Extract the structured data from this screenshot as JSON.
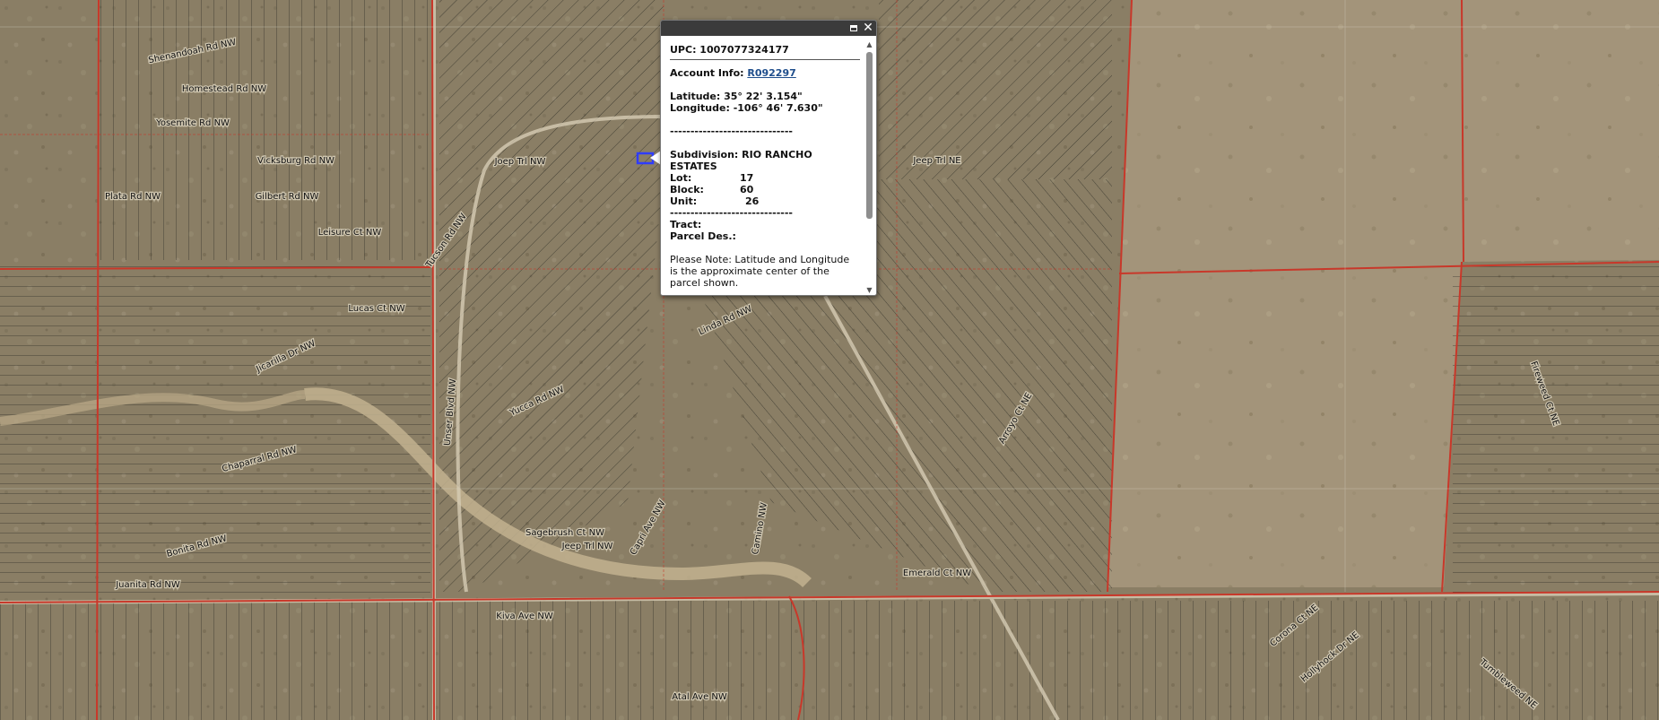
{
  "popup": {
    "upc": "UPC: 1007077324177",
    "account_label": "Account Info: ",
    "account_link": "R092297",
    "latitude": "Latitude: 35° 22' 3.154\"",
    "longitude": "Longitude: -106° 46' 7.630\"",
    "separator": "------------------------------",
    "subdivision": "Subdivision: RIO RANCHO ESTATES",
    "lot_label": "Lot:",
    "lot_value": "17",
    "block_label": "Block:",
    "block_value": "60",
    "unit_label": "Unit:",
    "unit_value": "26",
    "tract_label": "Tract:",
    "parcel_label": "Parcel Des.:",
    "note": "Please Note: Latitude and Longitude is the approximate center of the parcel shown.",
    "maximize_icon": "maximize-icon",
    "close_icon": "close-icon",
    "close_glyph": "✕"
  },
  "colors": {
    "terrain": "#8d8168",
    "parcel_line": "#2b2b24",
    "boundary": "#c8382a",
    "selected_parcel": "#2f3cff",
    "popup_titlebar": "#3b3b3b"
  },
  "street_labels": [
    {
      "text": "Shenandoah Rd NW"
    },
    {
      "text": "Homestead Rd NW"
    },
    {
      "text": "Yosemite Rd NW"
    },
    {
      "text": "Vicksburg Rd NW"
    },
    {
      "text": "Gilbert Rd NW"
    },
    {
      "text": "Leisure Ct NW"
    },
    {
      "text": "Plata Rd NW"
    },
    {
      "text": "Lucas Ct NW"
    },
    {
      "text": "Yucca Rd NW"
    },
    {
      "text": "Joep Trl NW"
    },
    {
      "text": "Juanita Rd NW"
    },
    {
      "text": "Jeep Trl NE"
    },
    {
      "text": "Emerald Ct NW"
    },
    {
      "text": "Atal Ave NW"
    },
    {
      "text": "Kiva Ave NW"
    },
    {
      "text": "Sagebrush Ct NW"
    },
    {
      "text": "Jeep Trl NW"
    },
    {
      "text": "Capri Ave NW"
    },
    {
      "text": "Bonita Rd NW"
    },
    {
      "text": "Arroyo Ct NE"
    },
    {
      "text": "Chaparral Rd NW"
    },
    {
      "text": "Jicarilla Dr NW"
    },
    {
      "text": "Tucson Rd NW"
    },
    {
      "text": "Unser Blvd NW"
    },
    {
      "text": "Tumbleweed NE"
    },
    {
      "text": "Hollyhock Dr NE"
    },
    {
      "text": "Fireweed Ct NE"
    },
    {
      "text": "Corona Ct NE"
    },
    {
      "text": "Camino NW"
    },
    {
      "text": "Linda Rd NW"
    }
  ]
}
